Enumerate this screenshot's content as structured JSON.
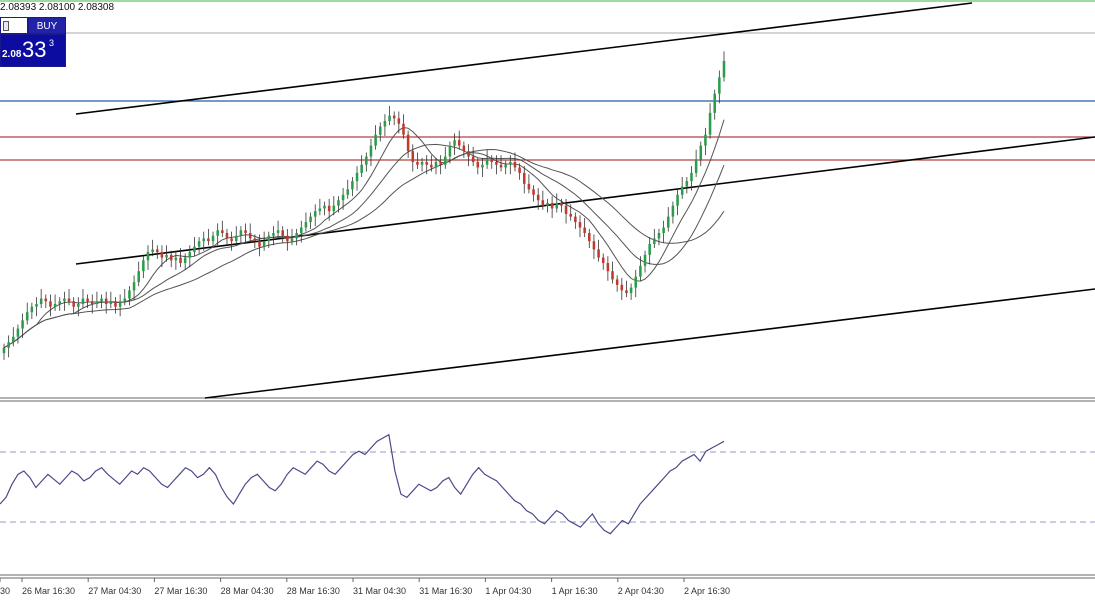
{
  "ohlc_text": "2.08393 2.08100 2.08308",
  "trade_panel": {
    "buy_label": "BUY",
    "price_small": "2.08",
    "price_big": "33",
    "price_sup": "3"
  },
  "colors": {
    "bull": "#2a9d4a",
    "bear": "#c0392b",
    "wick": "#333333",
    "channel": "#000000",
    "blue_level": "#1f5fa8",
    "red_level": "#b0413e",
    "green_top": "#3cb34a",
    "ma": "#555555",
    "rsi": "#4a4a8a",
    "rsi_level": "#9a9ac0"
  },
  "chart_data": [
    {
      "type": "line",
      "subtype": "candlestick",
      "title": "",
      "x_labels": [
        "30",
        "26 Mar 16:30",
        "27 Mar 04:30",
        "27 Mar 16:30",
        "28 Mar 04:30",
        "28 Mar 16:30",
        "31 Mar 04:30",
        "31 Mar 16:30",
        "1 Apr 04:30",
        "1 Apr 16:30",
        "2 Apr 04:30",
        "2 Apr 16:30"
      ],
      "close": [
        40,
        42,
        44,
        47,
        50,
        53,
        55,
        56,
        58,
        57,
        55,
        56,
        57,
        58,
        57,
        55,
        56,
        58,
        57,
        56,
        57,
        58,
        56,
        57,
        55,
        57,
        58,
        61,
        64,
        68,
        72,
        75,
        76,
        75,
        73,
        74,
        72,
        73,
        71,
        73,
        75,
        77,
        79,
        80,
        79,
        81,
        83,
        82,
        80,
        79,
        81,
        83,
        82,
        80,
        79,
        77,
        79,
        81,
        82,
        83,
        81,
        79,
        80,
        82,
        84,
        86,
        88,
        90,
        91,
        92,
        90,
        92,
        94,
        96,
        98,
        101,
        104,
        107,
        110,
        114,
        118,
        121,
        123,
        125,
        124,
        122,
        118,
        112,
        108,
        107,
        108,
        107,
        106,
        108,
        107,
        110,
        114,
        116,
        114,
        112,
        110,
        108,
        106,
        107,
        109,
        108,
        107,
        106,
        107,
        108,
        106,
        104,
        100,
        98,
        96,
        94,
        92,
        93,
        91,
        93,
        92,
        89,
        88,
        86,
        84,
        82,
        79,
        76,
        73,
        71,
        68,
        65,
        63,
        61,
        60,
        62,
        66,
        70,
        74,
        78,
        80,
        82,
        84,
        88,
        92,
        96,
        99,
        101,
        104,
        109,
        114,
        118,
        126,
        133,
        139,
        145
      ],
      "ylim": [
        30,
        160
      ],
      "overlays": [
        "moving average 1",
        "moving average 2",
        "moving average 3"
      ],
      "horizontal_levels": [
        {
          "name": "upper",
          "value": 155
        },
        {
          "name": "blue",
          "value": 136
        },
        {
          "name": "red-upper",
          "value": 126
        },
        {
          "name": "red-lower",
          "value": 120
        }
      ]
    },
    {
      "type": "line",
      "title": "",
      "values": [
        40,
        44,
        52,
        58,
        60,
        56,
        50,
        54,
        58,
        55,
        52,
        56,
        60,
        58,
        54,
        56,
        60,
        62,
        58,
        55,
        52,
        56,
        60,
        58,
        62,
        60,
        56,
        52,
        50,
        54,
        58,
        62,
        60,
        56,
        58,
        62,
        58,
        50,
        44,
        40,
        46,
        52,
        56,
        58,
        54,
        50,
        48,
        52,
        58,
        62,
        60,
        58,
        62,
        66,
        64,
        60,
        58,
        62,
        66,
        70,
        72,
        70,
        74,
        78,
        80,
        82,
        60,
        46,
        44,
        48,
        52,
        50,
        48,
        50,
        54,
        56,
        50,
        46,
        52,
        58,
        62,
        58,
        56,
        54,
        50,
        46,
        42,
        40,
        36,
        34,
        30,
        28,
        32,
        36,
        34,
        30,
        28,
        26,
        30,
        34,
        28,
        24,
        22,
        26,
        30,
        28,
        34,
        40,
        44,
        48,
        52,
        56,
        60,
        62,
        66,
        68,
        70,
        66,
        72,
        74,
        76,
        78
      ],
      "ylim": [
        0,
        100
      ],
      "levels": [
        70,
        30
      ]
    }
  ]
}
